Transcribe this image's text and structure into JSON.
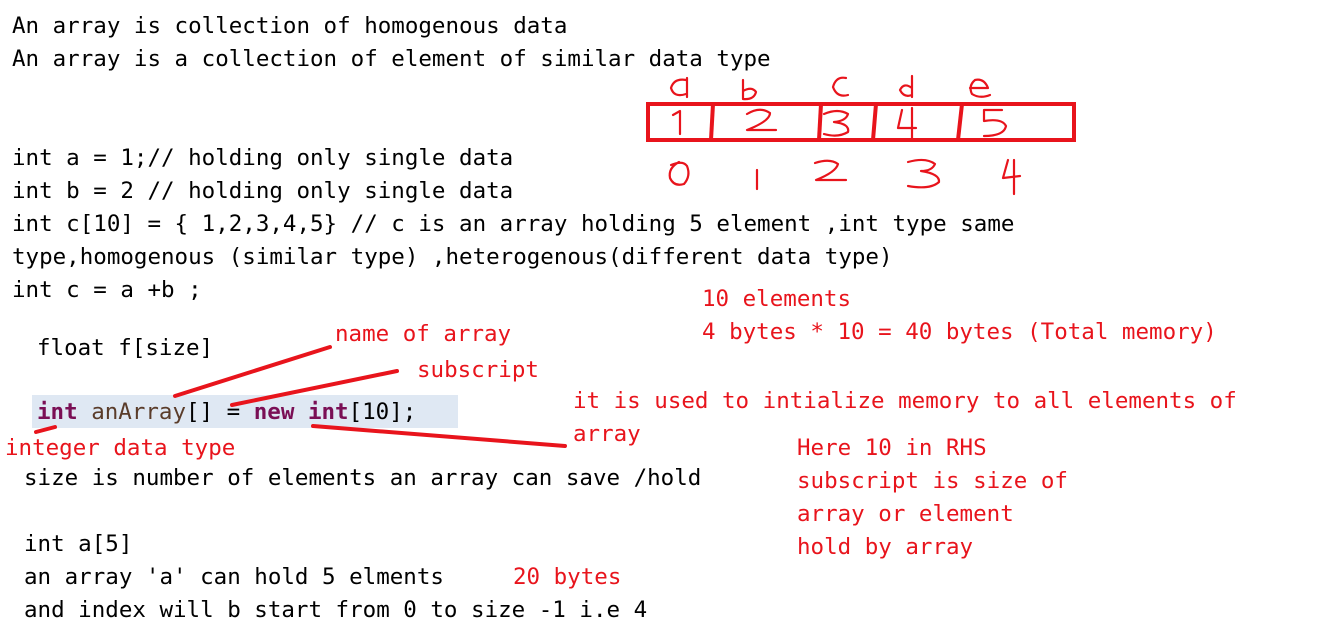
{
  "lines": {
    "l1": "An array is collection of homogenous data",
    "l2": "An array is a collection of element of similar data type",
    "l3": "int a = 1;// holding only single data",
    "l4": "int b = 2 // holding only single data",
    "l5": "int c[10] = { 1,2,3,4,5} // c is an array holding 5 element ,int type same",
    "l6": "type,homogenous (similar type) ,heterogenous(different data type)",
    "l7": "int c = a +b ;",
    "l8": "float f[size]",
    "l10": "size is number of elements an array can save /hold",
    "l11": "int a[5]",
    "l12": "an array 'a' can hold 5 elments",
    "l13": "and index will b start from 0 to size -1 i.e 4"
  },
  "code": {
    "kw_int": "int",
    "ident": "anArray",
    "mid": "[] = ",
    "kw_new": "new",
    "kw_int2": "int",
    "tail": "[10];"
  },
  "notes": {
    "elements": "10 elements",
    "memory": "4 bytes * 10 = 40 bytes (Total memory)",
    "name_of_array": "name of array",
    "subscript": "subscript",
    "init1": "it is used to intialize memory to all elements of",
    "init2": "array",
    "int_type": "integer data type",
    "rhs1": "Here 10 in RHS",
    "rhs2": "subscript is size of",
    "rhs3": "array or element",
    "rhs4": "hold by array",
    "bytes20": "20 bytes"
  },
  "colors": {
    "annotation": "#e8141c",
    "keyword": "#7a0f55",
    "highlight": "#dfe8f3"
  }
}
